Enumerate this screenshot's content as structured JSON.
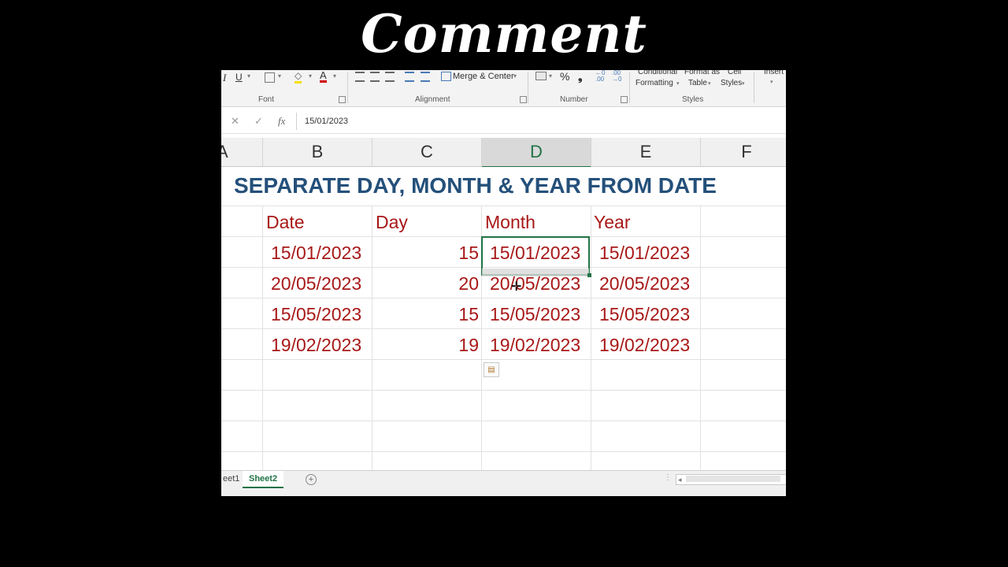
{
  "overlay": {
    "title": "Comment"
  },
  "ribbon": {
    "italic": "I",
    "underline": "U",
    "font_color": "A",
    "merge_center": "Merge & Center",
    "percent": "%",
    "comma": "❟",
    "conditional_formatting_1": "Conditional",
    "conditional_formatting_2": "Formatting",
    "format_as_table_1": "Format as",
    "format_as_table_2": "Table",
    "cell_styles_1": "Cell",
    "cell_styles_2": "Styles",
    "insert": "Insert",
    "group_font": "Font",
    "group_alignment": "Alignment",
    "group_number": "Number",
    "group_styles": "Styles"
  },
  "formula_bar": {
    "cancel": "✕",
    "enter": "✓",
    "fx": "fx",
    "value": "15/01/2023"
  },
  "columns": {
    "a": "A",
    "b": "B",
    "c": "C",
    "d": "D",
    "e": "E",
    "f": "F"
  },
  "sheet": {
    "title": "SEPARATE DAY, MONTH & YEAR FROM DATE",
    "headers": {
      "date": "Date",
      "day": "Day",
      "month": "Month",
      "year": "Year"
    },
    "rows": [
      {
        "date": "15/01/2023",
        "day": "15",
        "month": "15/01/2023",
        "year": "15/01/2023"
      },
      {
        "date": "20/05/2023",
        "day": "20",
        "month": "20/05/2023",
        "year": "20/05/2023"
      },
      {
        "date": "15/05/2023",
        "day": "15",
        "month": "15/05/2023",
        "year": "15/05/2023"
      },
      {
        "date": "19/02/2023",
        "day": "19",
        "month": "19/02/2023",
        "year": "19/02/2023"
      }
    ]
  },
  "tabs": {
    "sheet1": "eet1",
    "sheet2": "Sheet2"
  },
  "colors": {
    "accent": "#217346",
    "title": "#24507a",
    "data_text": "#a81818"
  }
}
